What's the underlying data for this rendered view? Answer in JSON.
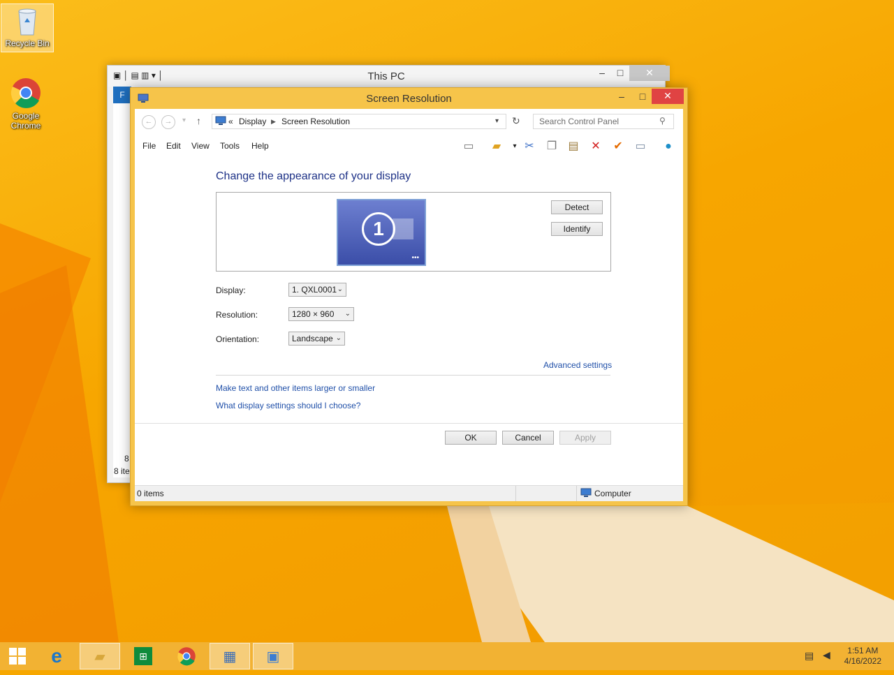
{
  "desktop": {
    "icons": [
      {
        "label": "Recycle Bin"
      },
      {
        "label": "Google Chrome"
      }
    ]
  },
  "back_window": {
    "title": "This PC",
    "status_items": "8 ite",
    "left_count": "8"
  },
  "window": {
    "title": "Screen Resolution",
    "breadcrumb": {
      "sep": "«",
      "items": [
        "Display",
        "Screen Resolution"
      ]
    },
    "search_placeholder": "Search Control Panel",
    "menu": [
      "File",
      "Edit",
      "View",
      "Tools",
      "Help"
    ],
    "heading": "Change the appearance of your display",
    "monitor_number": "1",
    "buttons": {
      "detect": "Detect",
      "identify": "Identify",
      "ok": "OK",
      "cancel": "Cancel",
      "apply": "Apply"
    },
    "fields": {
      "display": {
        "label": "Display:",
        "value": "1. QXL0001"
      },
      "resolution": {
        "label": "Resolution:",
        "value": "1280 × 960"
      },
      "orientation": {
        "label": "Orientation:",
        "value": "Landscape"
      }
    },
    "links": {
      "advanced": "Advanced settings",
      "text_size": "Make text and other items larger or smaller",
      "which_settings": "What display settings should I choose?"
    },
    "status": {
      "items": "0 items",
      "location": "Computer"
    }
  },
  "taskbar": {
    "clock_time": "1:51 AM",
    "clock_date": "4/16/2022"
  },
  "colors": {
    "accent_link": "#1f4fa8",
    "heading": "#1e3287",
    "window_frame": "#f6c44a",
    "close_red": "#e04343"
  }
}
